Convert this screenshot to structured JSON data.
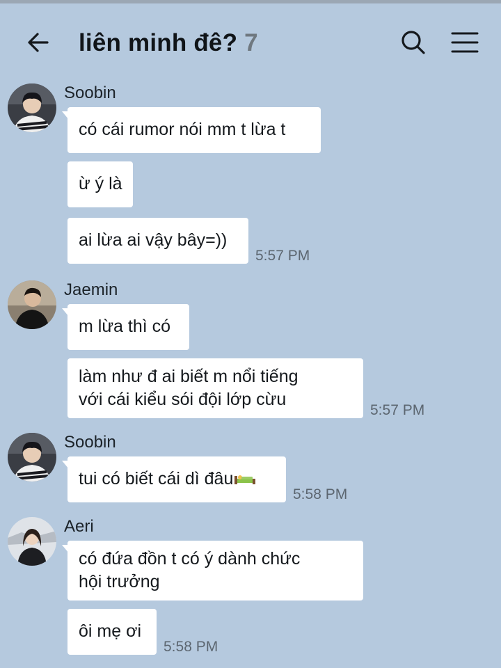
{
  "header": {
    "title": "liên minh đê?",
    "member_count": "7",
    "back_icon": "arrow-left-icon",
    "search_icon": "search-icon",
    "menu_icon": "hamburger-menu-icon"
  },
  "messages": [
    {
      "sender": "Soobin",
      "texts": [
        "có cái rumor nói mm t lừa t",
        "ừ ý là",
        "ai lừa ai vậy bây=))"
      ],
      "time": "5:57 PM"
    },
    {
      "sender": "Jaemin",
      "texts": [
        "m lừa thì có",
        "làm như đ ai biết m nổi tiếng\nvới cái kiểu sói đội lớp cừu"
      ],
      "time": "5:57 PM"
    },
    {
      "sender": "Soobin",
      "texts": [
        "tui có biết cái dì đâu"
      ],
      "emoji": "bed-emoji",
      "time": "5:58 PM"
    },
    {
      "sender": "Aeri",
      "texts": [
        "có đứa đồn t có ý dành chức\nhội trưởng",
        "ôi mẹ ơi"
      ],
      "time": "5:58 PM"
    }
  ],
  "colors": {
    "background": "#b5c9de",
    "bubble": "#ffffff",
    "timestamp": "#5c6670",
    "count": "#6f7880"
  }
}
